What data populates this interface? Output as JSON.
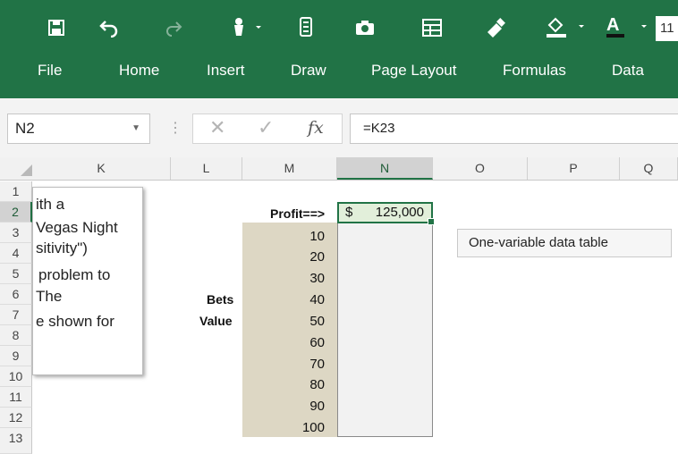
{
  "app": {
    "font_size_value": "11",
    "accent_color": "#217346"
  },
  "toolbar": {
    "icons": [
      "save-icon",
      "undo-icon",
      "redo-icon",
      "touch-mode-icon",
      "form-icon",
      "camera-icon",
      "table-icon",
      "format-painter-icon",
      "fill-color-icon",
      "font-color-icon"
    ]
  },
  "ribbon": {
    "tabs": [
      "File",
      "Home",
      "Insert",
      "Draw",
      "Page Layout",
      "Formulas",
      "Data"
    ]
  },
  "formula_bar": {
    "name_box": "N2",
    "fx_label": "fx",
    "formula": "=K23"
  },
  "columns": [
    "K",
    "L",
    "M",
    "N",
    "O",
    "P",
    "Q"
  ],
  "rows": [
    "1",
    "2",
    "3",
    "4",
    "5",
    "6",
    "7",
    "8",
    "9",
    "10",
    "11",
    "12",
    "13"
  ],
  "textbox": {
    "lines": [
      "ith a",
      "Vegas Night",
      "sitivity\")",
      "problem to",
      "The",
      "e shown for"
    ]
  },
  "sheet": {
    "profit_label": "Profit==>",
    "profit_currency": "$",
    "profit_value": "125,000",
    "bets_label": "Bets",
    "value_label": "Value",
    "bet_values": [
      "10",
      "20",
      "30",
      "40",
      "50",
      "60",
      "70",
      "80",
      "90",
      "100"
    ],
    "note": "One-variable data table"
  }
}
